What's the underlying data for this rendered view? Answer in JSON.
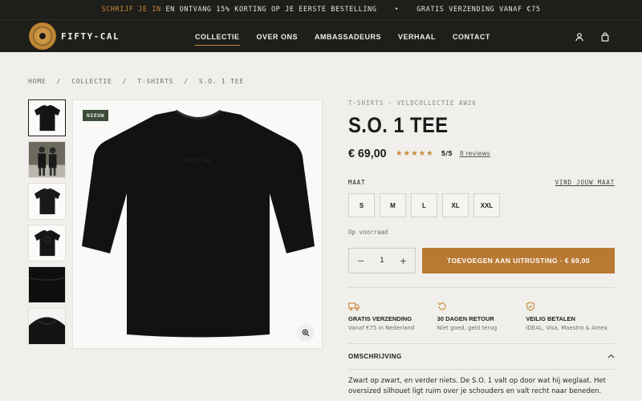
{
  "announcement": {
    "highlight": "SCHRIJF JE IN",
    "text": "EN ONTVANG 15% KORTING OP JE EERSTE BESTELLING",
    "separator": "•",
    "shipping": "GRATIS VERZENDING VANAF €75"
  },
  "brand": {
    "name": "FIFTY-CAL",
    "logo_icon": "round-seal-logo"
  },
  "nav": {
    "items": [
      {
        "label": "COLLECTIE",
        "active": true
      },
      {
        "label": "OVER ONS"
      },
      {
        "label": "AMBASSADEURS"
      },
      {
        "label": "VERHAAL"
      },
      {
        "label": "CONTACT"
      }
    ]
  },
  "header_icons": [
    "account-icon",
    "bag-icon"
  ],
  "breadcrumb": [
    "HOME",
    "/",
    "COLLECTIE",
    "/",
    "T-SHIRTS",
    "/",
    "S.O. 1 TEE"
  ],
  "gallery": {
    "badge": "NIEUW",
    "zoom_icon": "zoom-icon",
    "thumb_count": 6
  },
  "product": {
    "eyebrow": "T-SHIRTS · VELDCOLLECTIE AW26",
    "title": "S.O. 1 TEE",
    "price": "€ 69,00",
    "stars": "★★★★★",
    "rating": "5/5",
    "reviews": "8 reviews",
    "size_label": "MAAT",
    "size_guide": "VIND JOUW MAAT",
    "sizes": [
      "S",
      "M",
      "L",
      "XL",
      "XXL"
    ],
    "stock": "Op voorraad",
    "quantity": "1",
    "qty_minus": "−",
    "qty_plus": "+",
    "add_to_cart": "TOEVOEGEN AAN UITRUSTING · € 69,00"
  },
  "usps": [
    {
      "icon": "truck-icon",
      "title": "GRATIS VERZENDING",
      "sub": "Vanaf €75 in Nederland"
    },
    {
      "icon": "return-icon",
      "title": "30 DAGEN RETOUR",
      "sub": "Niet goed, geld terug"
    },
    {
      "icon": "shield-icon",
      "title": "VEILIG BETALEN",
      "sub": "iDEAL, Visa, Maestro & Amex"
    }
  ],
  "description": {
    "heading": "OMSCHRIJVING",
    "toggle_icon": "chevron-up-icon",
    "text": "Zwart op zwart, en verder niets. De S.O. 1 valt op door wat hij weglaat. Het oversized silhouet ligt ruim over je schouders en valt recht naar beneden."
  },
  "colors": {
    "dark": "#1e1e1b",
    "accent": "#b87932",
    "badge": "#3b4d38",
    "background": "#f1efeb"
  }
}
